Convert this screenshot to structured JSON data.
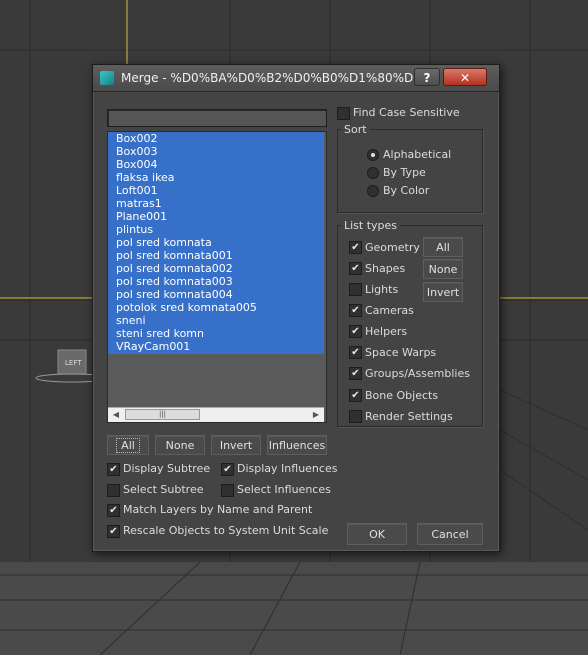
{
  "viewport": {
    "left_label": "LEFT"
  },
  "dialog": {
    "title": "Merge - %D0%BA%D0%B2%D0%B0%D1%80%D1%8...",
    "help_label": "?",
    "close_label": "✕"
  },
  "search": {
    "value": ""
  },
  "objects": {
    "items": [
      "Box002",
      "Box003",
      "Box004",
      "flaksa ikea",
      "Loft001",
      "matras1",
      "Plane001",
      "plintus",
      "pol sred komnata",
      "pol sred komnata001",
      "pol sred komnata002",
      "pol sred komnata003",
      "pol sred komnata004",
      "potolok sred komnata005",
      "sneni",
      "steni sred komn",
      "VRayCam001"
    ]
  },
  "list_buttons": {
    "all": "All",
    "none": "None",
    "invert": "Invert",
    "influences": "Influences"
  },
  "options": {
    "display_subtree": {
      "label": "Display Subtree",
      "checked": true
    },
    "display_influences": {
      "label": "Display Influences",
      "checked": true
    },
    "select_subtree": {
      "label": "Select Subtree",
      "checked": false
    },
    "select_influences": {
      "label": "Select Influences",
      "checked": false
    },
    "match_layers": {
      "label": "Match Layers by Name and Parent",
      "checked": true
    },
    "rescale": {
      "label": "Rescale Objects to System Unit Scale",
      "checked": true
    }
  },
  "find_case": {
    "label": "Find Case Sensitive",
    "checked": false
  },
  "sort": {
    "title": "Sort",
    "options": [
      {
        "label": "Alphabetical",
        "selected": true
      },
      {
        "label": "By Type",
        "selected": false
      },
      {
        "label": "By Color",
        "selected": false
      }
    ]
  },
  "list_types": {
    "title": "List types",
    "items": [
      {
        "label": "Geometry",
        "checked": true
      },
      {
        "label": "Shapes",
        "checked": true
      },
      {
        "label": "Lights",
        "checked": false
      },
      {
        "label": "Cameras",
        "checked": true
      },
      {
        "label": "Helpers",
        "checked": true
      },
      {
        "label": "Space Warps",
        "checked": true
      },
      {
        "label": "Groups/Assemblies",
        "checked": true
      },
      {
        "label": "Bone Objects",
        "checked": true
      },
      {
        "label": "Render Settings",
        "checked": false
      }
    ],
    "all": "All",
    "none": "None",
    "invert": "Invert"
  },
  "footer": {
    "ok": "OK",
    "cancel": "Cancel"
  },
  "colors": {
    "selection": "#3770c8",
    "dialog_bg": "#444444",
    "viewport_bg": "#3a3a3a"
  }
}
